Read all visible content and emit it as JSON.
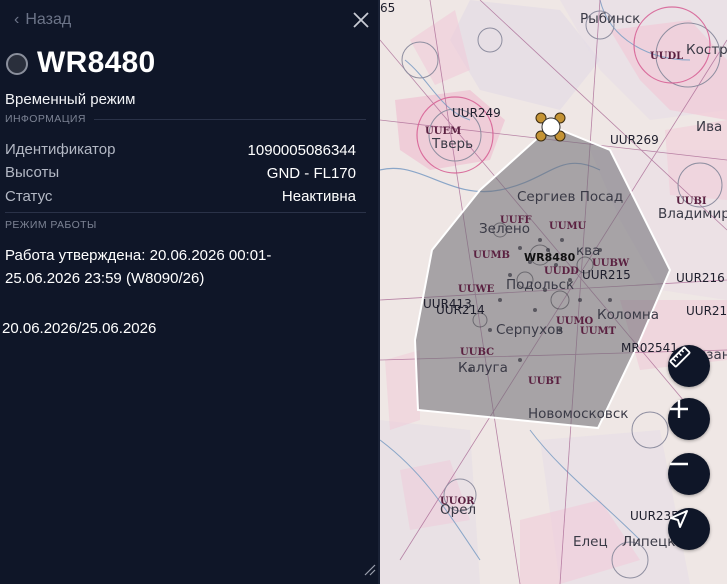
{
  "panel": {
    "back_label": "Назад",
    "title": "WR8480",
    "subtitle": "Временный режим",
    "info_section": "ИНФОРМАЦИЯ",
    "rows": [
      {
        "label": "Идентификатор",
        "value": "1090005086344"
      },
      {
        "label": "Высоты",
        "value": "GND - FL170"
      },
      {
        "label": "Статус",
        "value": "Неактивна"
      }
    ],
    "mode_section": "РЕЖИМ РАБОТЫ",
    "approval_line1": "Работа утверждена: 20.06.2026 00:01-",
    "approval_line2": "25.06.2026 23:59 (W8090/26)",
    "date_range": "20.06.2026/25.06.2026"
  },
  "map": {
    "cities": {
      "rybinsk": "Рыбинск",
      "kostroma": "Костр",
      "tver": "Тверь",
      "ivanovo": "Ива",
      "sergiev": "Сергиев Посад",
      "vladimir": "Владимир",
      "zelenograd": "Зелено",
      "moskva": "ква",
      "podolsk": "Подольск",
      "kolomna": "Коломна",
      "serpukhov": "Серпухов",
      "kaluga": "Калуга",
      "ryazan": "Рязан",
      "novomoskovsk": "Новомосковск",
      "orel": "Орел",
      "elets": "Елец",
      "lipetsk": "Липецк"
    },
    "codes": {
      "uur249": "UUR249",
      "uur269": "UUR269",
      "uur215": "UUR215",
      "uur216": "UUR216",
      "uur21": "UUR21",
      "uur214": "UUR214",
      "uur413": "UUR413",
      "uur235": "UUR235",
      "mr02541": "MR02541",
      "n65": "65"
    },
    "airports": {
      "uudl": "UUDL",
      "uem": "UUEM",
      "uubi": "UUBI",
      "uuff": "UUFF",
      "uumu": "UUMU",
      "uumb": "UUMB",
      "uudd": "UUDD",
      "uubw": "UUBW",
      "uuwe": "UUWE",
      "uumo": "UUMO",
      "uumt": "UUMT",
      "uubc": "UUBC",
      "uubt": "UUBT",
      "uuor": "UUOR"
    },
    "zone_label": "WR8480"
  },
  "controls": {
    "ruler": "ruler-icon",
    "zoom_in": "plus-icon",
    "zoom_out": "minus-icon",
    "locate": "navigation-arrow-icon"
  }
}
